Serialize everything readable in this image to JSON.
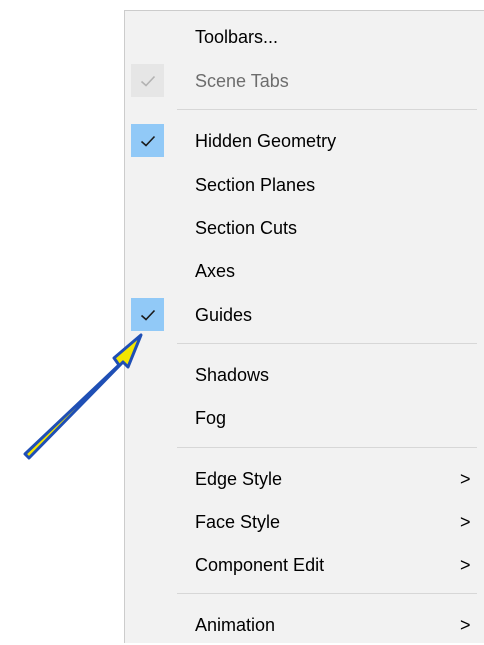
{
  "menu": {
    "items": [
      {
        "label": "Toolbars..."
      },
      {
        "label": "Scene Tabs",
        "checked": true,
        "disabled": true
      },
      {
        "label": "Hidden Geometry",
        "checked": true
      },
      {
        "label": "Section Planes"
      },
      {
        "label": "Section Cuts"
      },
      {
        "label": "Axes"
      },
      {
        "label": "Guides",
        "checked": true
      },
      {
        "label": "Shadows"
      },
      {
        "label": "Fog"
      },
      {
        "label": "Edge Style",
        "submenu": true
      },
      {
        "label": "Face Style",
        "submenu": true
      },
      {
        "label": "Component Edit",
        "submenu": true
      },
      {
        "label": "Animation",
        "submenu": true
      }
    ],
    "submenu_glyph": ">",
    "colors": {
      "checked_bg": "#91c9f7",
      "disabled_check_bg": "#e6e6e6",
      "menu_bg": "#f2f2f2"
    }
  },
  "annotation": {
    "icon": "arrow-icon",
    "fill": "#f4e600",
    "outline": "#1f4fb5"
  }
}
